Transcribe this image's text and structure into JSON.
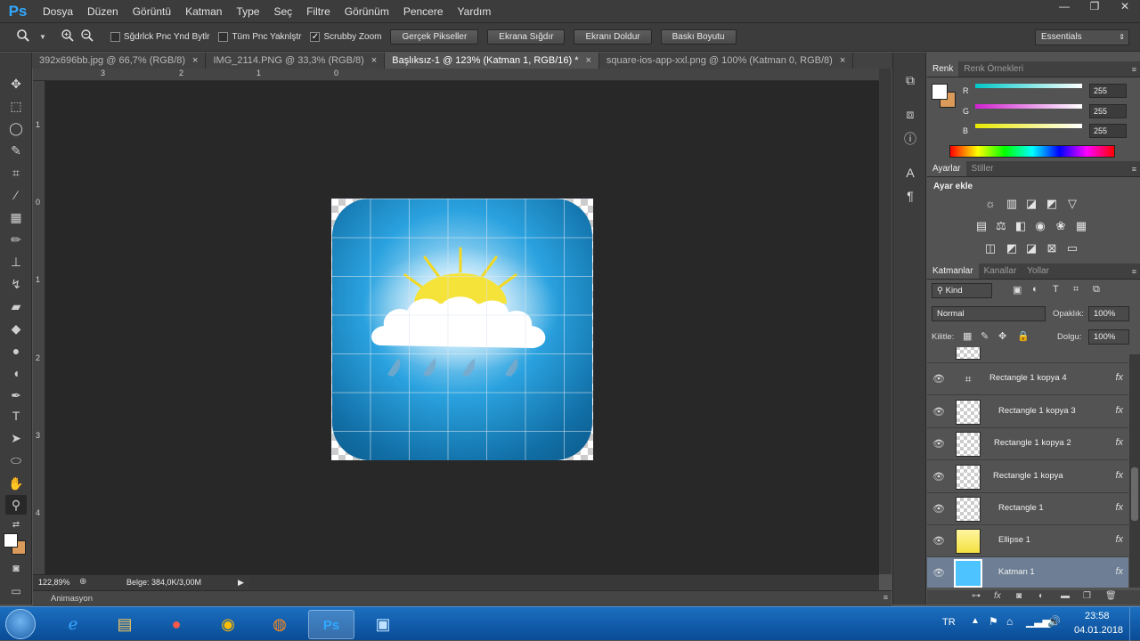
{
  "app": {
    "logo": "Ps"
  },
  "menubar": {
    "items": [
      "Dosya",
      "Düzen",
      "Görüntü",
      "Katman",
      "Type",
      "Seç",
      "Filtre",
      "Görünüm",
      "Pencere",
      "Yardım"
    ]
  },
  "window_controls": {
    "minimize": "—",
    "restore": "❐",
    "close": "✕"
  },
  "options": {
    "zoom_tool_icon": "zoom-icon",
    "checkboxes": [
      {
        "label": "Sğdrlck Pnc Ynd Bytlr",
        "checked": false
      },
      {
        "label": "Tüm Pnc Yaknlştr",
        "checked": false
      },
      {
        "label": "Scrubby Zoom",
        "checked": true
      }
    ],
    "buttons": [
      "Gerçek Pikseller",
      "Ekrana Sığdır",
      "Ekranı Doldur",
      "Baskı Boyutu"
    ],
    "workspace": "Essentials"
  },
  "tabs": [
    {
      "label": "392x696bb.jpg @ 66,7% (RGB/8)",
      "active": false,
      "close": "×"
    },
    {
      "label": "IMG_2114.PNG @ 33,3% (RGB/8)",
      "active": false,
      "close": "×"
    },
    {
      "label": "Başlıksız-1 @ 123% (Katman 1, RGB/16) *",
      "active": true,
      "close": "×"
    },
    {
      "label": "square-ios-app-xxl.png @ 100% (Katman 0, RGB/8)",
      "active": false,
      "close": "×"
    }
  ],
  "ruler": {
    "h_labels": [
      "3",
      "2",
      "1",
      "0"
    ],
    "v_labels": [
      "1",
      "0",
      "1",
      "2",
      "3",
      "4"
    ]
  },
  "status": {
    "zoom": "122,89%",
    "doc_info": "Belge: 384,0K/3,00M",
    "arrow": "▶"
  },
  "animation_panel": {
    "label": "Animasyon"
  },
  "color_panel": {
    "tabs": [
      "Renk",
      "Renk Örnekleri"
    ],
    "channels": [
      {
        "label": "R",
        "value": "255",
        "color": "#00c8c8"
      },
      {
        "label": "G",
        "value": "255",
        "color": "#d020d0"
      },
      {
        "label": "B",
        "value": "255",
        "color": "#e8e800"
      }
    ],
    "fg_color": "#ffffff",
    "bg_color": "#d99a5a"
  },
  "adjustments_panel": {
    "tabs": [
      "Ayarlar",
      "Stiller"
    ],
    "title": "Ayar ekle"
  },
  "layers_panel": {
    "tabs": [
      "Katmanlar",
      "Kanallar",
      "Yollar"
    ],
    "filter": "Kind",
    "blend_mode": "Normal",
    "opacity_label": "Opaklık:",
    "opacity": "100%",
    "lock_label": "Kilitle:",
    "fill_label": "Dolgu:",
    "fill": "100%",
    "layers": [
      {
        "name": "Rectangle 1 kopya 4",
        "selected": false,
        "fx": "fx"
      },
      {
        "name": "Rectangle 1 kopya 3",
        "selected": false,
        "fx": "fx"
      },
      {
        "name": "Rectangle 1 kopya 2",
        "selected": false,
        "fx": "fx"
      },
      {
        "name": "Rectangle 1 kopya",
        "selected": false,
        "fx": "fx"
      },
      {
        "name": "Rectangle 1",
        "selected": false,
        "fx": "fx"
      },
      {
        "name": "Ellipse 1",
        "selected": false,
        "fx": "fx"
      },
      {
        "name": "Katman 1",
        "selected": true,
        "fx": "fx"
      }
    ]
  },
  "taskbar": {
    "language": "TR",
    "time": "23:58",
    "date": "04.01.2018",
    "apps": [
      "windows-start-icon",
      "internet-explorer-icon",
      "file-explorer-icon",
      "tray-app-icon",
      "chrome-icon",
      "firefox-icon",
      "photoshop-icon",
      "photos-icon"
    ]
  }
}
